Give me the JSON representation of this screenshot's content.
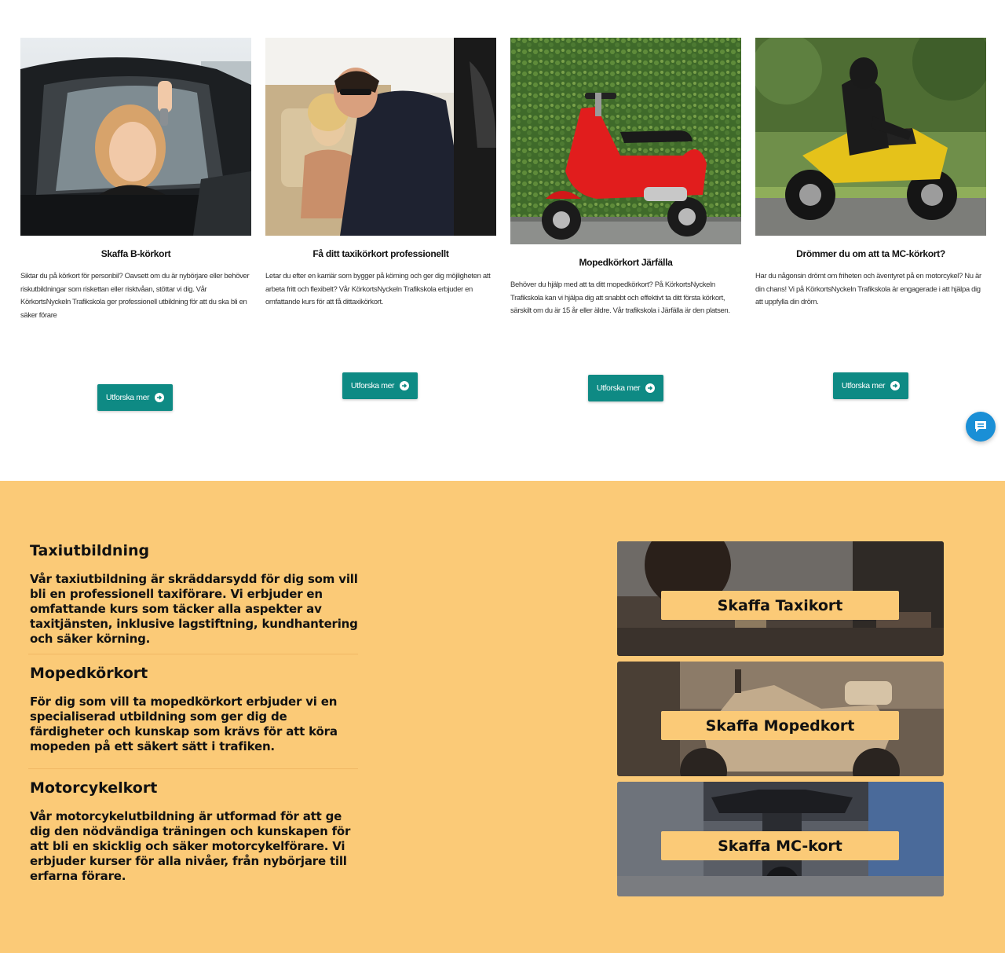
{
  "cards": [
    {
      "title": "Skaffa B-körkort",
      "description": "Siktar du på körkort för personbil? Oavsett om du är nybörjare eller behöver riskutbildningar som riskettan eller risktvåan, stöttar vi dig. Vår KörkortsNyckeln Trafikskola ger professionell utbildning för att du ska bli en säker förare",
      "button": "Utforska mer",
      "image": "woman-in-car-with-keys"
    },
    {
      "title": "Få ditt taxikörkort professionellt",
      "description": "Letar du efter en karriär som bygger på körning och ger dig möjligheten att arbeta fritt och flexibelt? Vår KörkortsNyckeln Trafikskola erbjuder en omfattande kurs för att få dittaxikörkort.",
      "button": "Utforska mer",
      "image": "taxi-driver-with-passenger"
    },
    {
      "title": "Mopedkörkort Järfälla",
      "description": "Behöver du hjälp med att ta ditt mopedkörkort? På KörkortsNyckeln Trafikskola kan vi hjälpa dig att snabbt och effektivt ta ditt första körkort, särskilt om du är 15 år eller äldre. Vår trafikskola i Järfälla är den platsen.",
      "button": "Utforska mer",
      "image": "red-scooter-hedge"
    },
    {
      "title": "Drömmer du om att ta MC-körkort?",
      "description": "Har du någonsin drömt om friheten och äventyret på en motorcykel? Nu är din chans! Vi på KörkortsNyckeln Trafikskola är engagerade i att hjälpa dig att uppfylla din dröm.",
      "button": "Utforska mer",
      "image": "yellow-motorcycle-rider"
    }
  ],
  "chat": {
    "icon": "chat-icon"
  },
  "services": [
    {
      "title": "Taxiutbildning",
      "text": "Vår taxiutbildning är skräddarsydd för dig som vill bli en professionell taxiförare. Vi erbjuder en omfattande kurs som täcker alla aspekter av taxitjänsten, inklusive lagstiftning, kundhantering och säker körning."
    },
    {
      "title": "Mopedkörkort",
      "text": "För dig som vill ta mopedkörkort erbjuder vi en specialiserad utbildning som ger dig de färdigheter och kunskap som krävs för att köra mopeden på ett säkert sätt i trafiken."
    },
    {
      "title": "Motorcykelkort",
      "text": "Vår motorcykelutbildning är utformad för att ge dig den nödvändiga träningen och kunskapen för att bli en skicklig och säker motorcykelförare. Vi erbjuder kurser för alla nivåer, från nybörjare till erfarna förare."
    }
  ],
  "tiles": [
    {
      "label": "Skaffa Taxikort",
      "image": "taxi-driver-city-traffic"
    },
    {
      "label": "Skaffa Mopedkort",
      "image": "beige-moped-street"
    },
    {
      "label": "Skaffa MC-kort",
      "image": "motorcycle-handlebars-traffic"
    }
  ],
  "colors": {
    "accent_button": "#0e8a84",
    "section_background": "#fbca77",
    "chat_button": "#1a8fd6"
  }
}
